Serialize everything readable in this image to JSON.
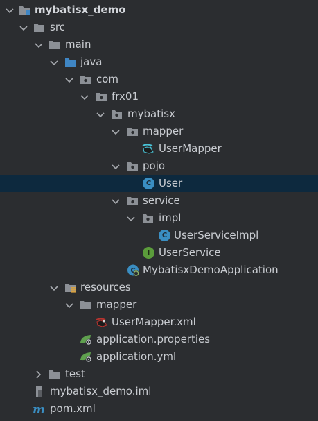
{
  "tree": {
    "project": {
      "label": "mybatisx_demo",
      "icon": "project-folder-icon",
      "expanded": true
    },
    "src": {
      "label": "src",
      "icon": "folder-icon",
      "expanded": true
    },
    "main": {
      "label": "main",
      "icon": "folder-icon",
      "expanded": true
    },
    "java": {
      "label": "java",
      "icon": "source-root-folder-icon",
      "expanded": true
    },
    "com": {
      "label": "com",
      "icon": "package-icon",
      "expanded": true
    },
    "frx01": {
      "label": "frx01",
      "icon": "package-icon",
      "expanded": true
    },
    "mybatisx": {
      "label": "mybatisx",
      "icon": "package-icon",
      "expanded": true
    },
    "mapper_pkg": {
      "label": "mapper",
      "icon": "package-icon",
      "expanded": true
    },
    "user_mapper": {
      "label": "UserMapper",
      "icon": "mybatis-mapper-icon"
    },
    "pojo": {
      "label": "pojo",
      "icon": "package-icon",
      "expanded": true
    },
    "user": {
      "label": "User",
      "icon": "class-icon",
      "selected": true
    },
    "service": {
      "label": "service",
      "icon": "package-icon",
      "expanded": true
    },
    "impl": {
      "label": "impl",
      "icon": "package-icon",
      "expanded": true
    },
    "user_service_impl": {
      "label": "UserServiceImpl",
      "icon": "class-icon"
    },
    "user_service": {
      "label": "UserService",
      "icon": "interface-icon"
    },
    "app": {
      "label": "MybatisxDemoApplication",
      "icon": "spring-boot-class-icon"
    },
    "resources": {
      "label": "resources",
      "icon": "resources-root-folder-icon",
      "expanded": true
    },
    "mapper_res": {
      "label": "mapper",
      "icon": "folder-icon",
      "expanded": true
    },
    "user_mapper_xml": {
      "label": "UserMapper.xml",
      "icon": "mybatis-xml-icon"
    },
    "app_properties": {
      "label": "application.properties",
      "icon": "spring-properties-icon"
    },
    "app_yml": {
      "label": "application.yml",
      "icon": "spring-yml-icon"
    },
    "test": {
      "label": "test",
      "icon": "folder-icon",
      "expanded": false
    },
    "iml": {
      "label": "mybatisx_demo.iml",
      "icon": "iml-file-icon"
    },
    "pom": {
      "label": "pom.xml",
      "icon": "maven-icon"
    }
  },
  "colors": {
    "background": "#2b2d30",
    "selection": "#0d293e",
    "text": "#c9ccd1",
    "folder": "#8c9096",
    "source_root": "#3f86c4",
    "class_badge": "#3a8ec2",
    "interface_badge": "#5b9c3b",
    "spring": "#5fa04e"
  }
}
